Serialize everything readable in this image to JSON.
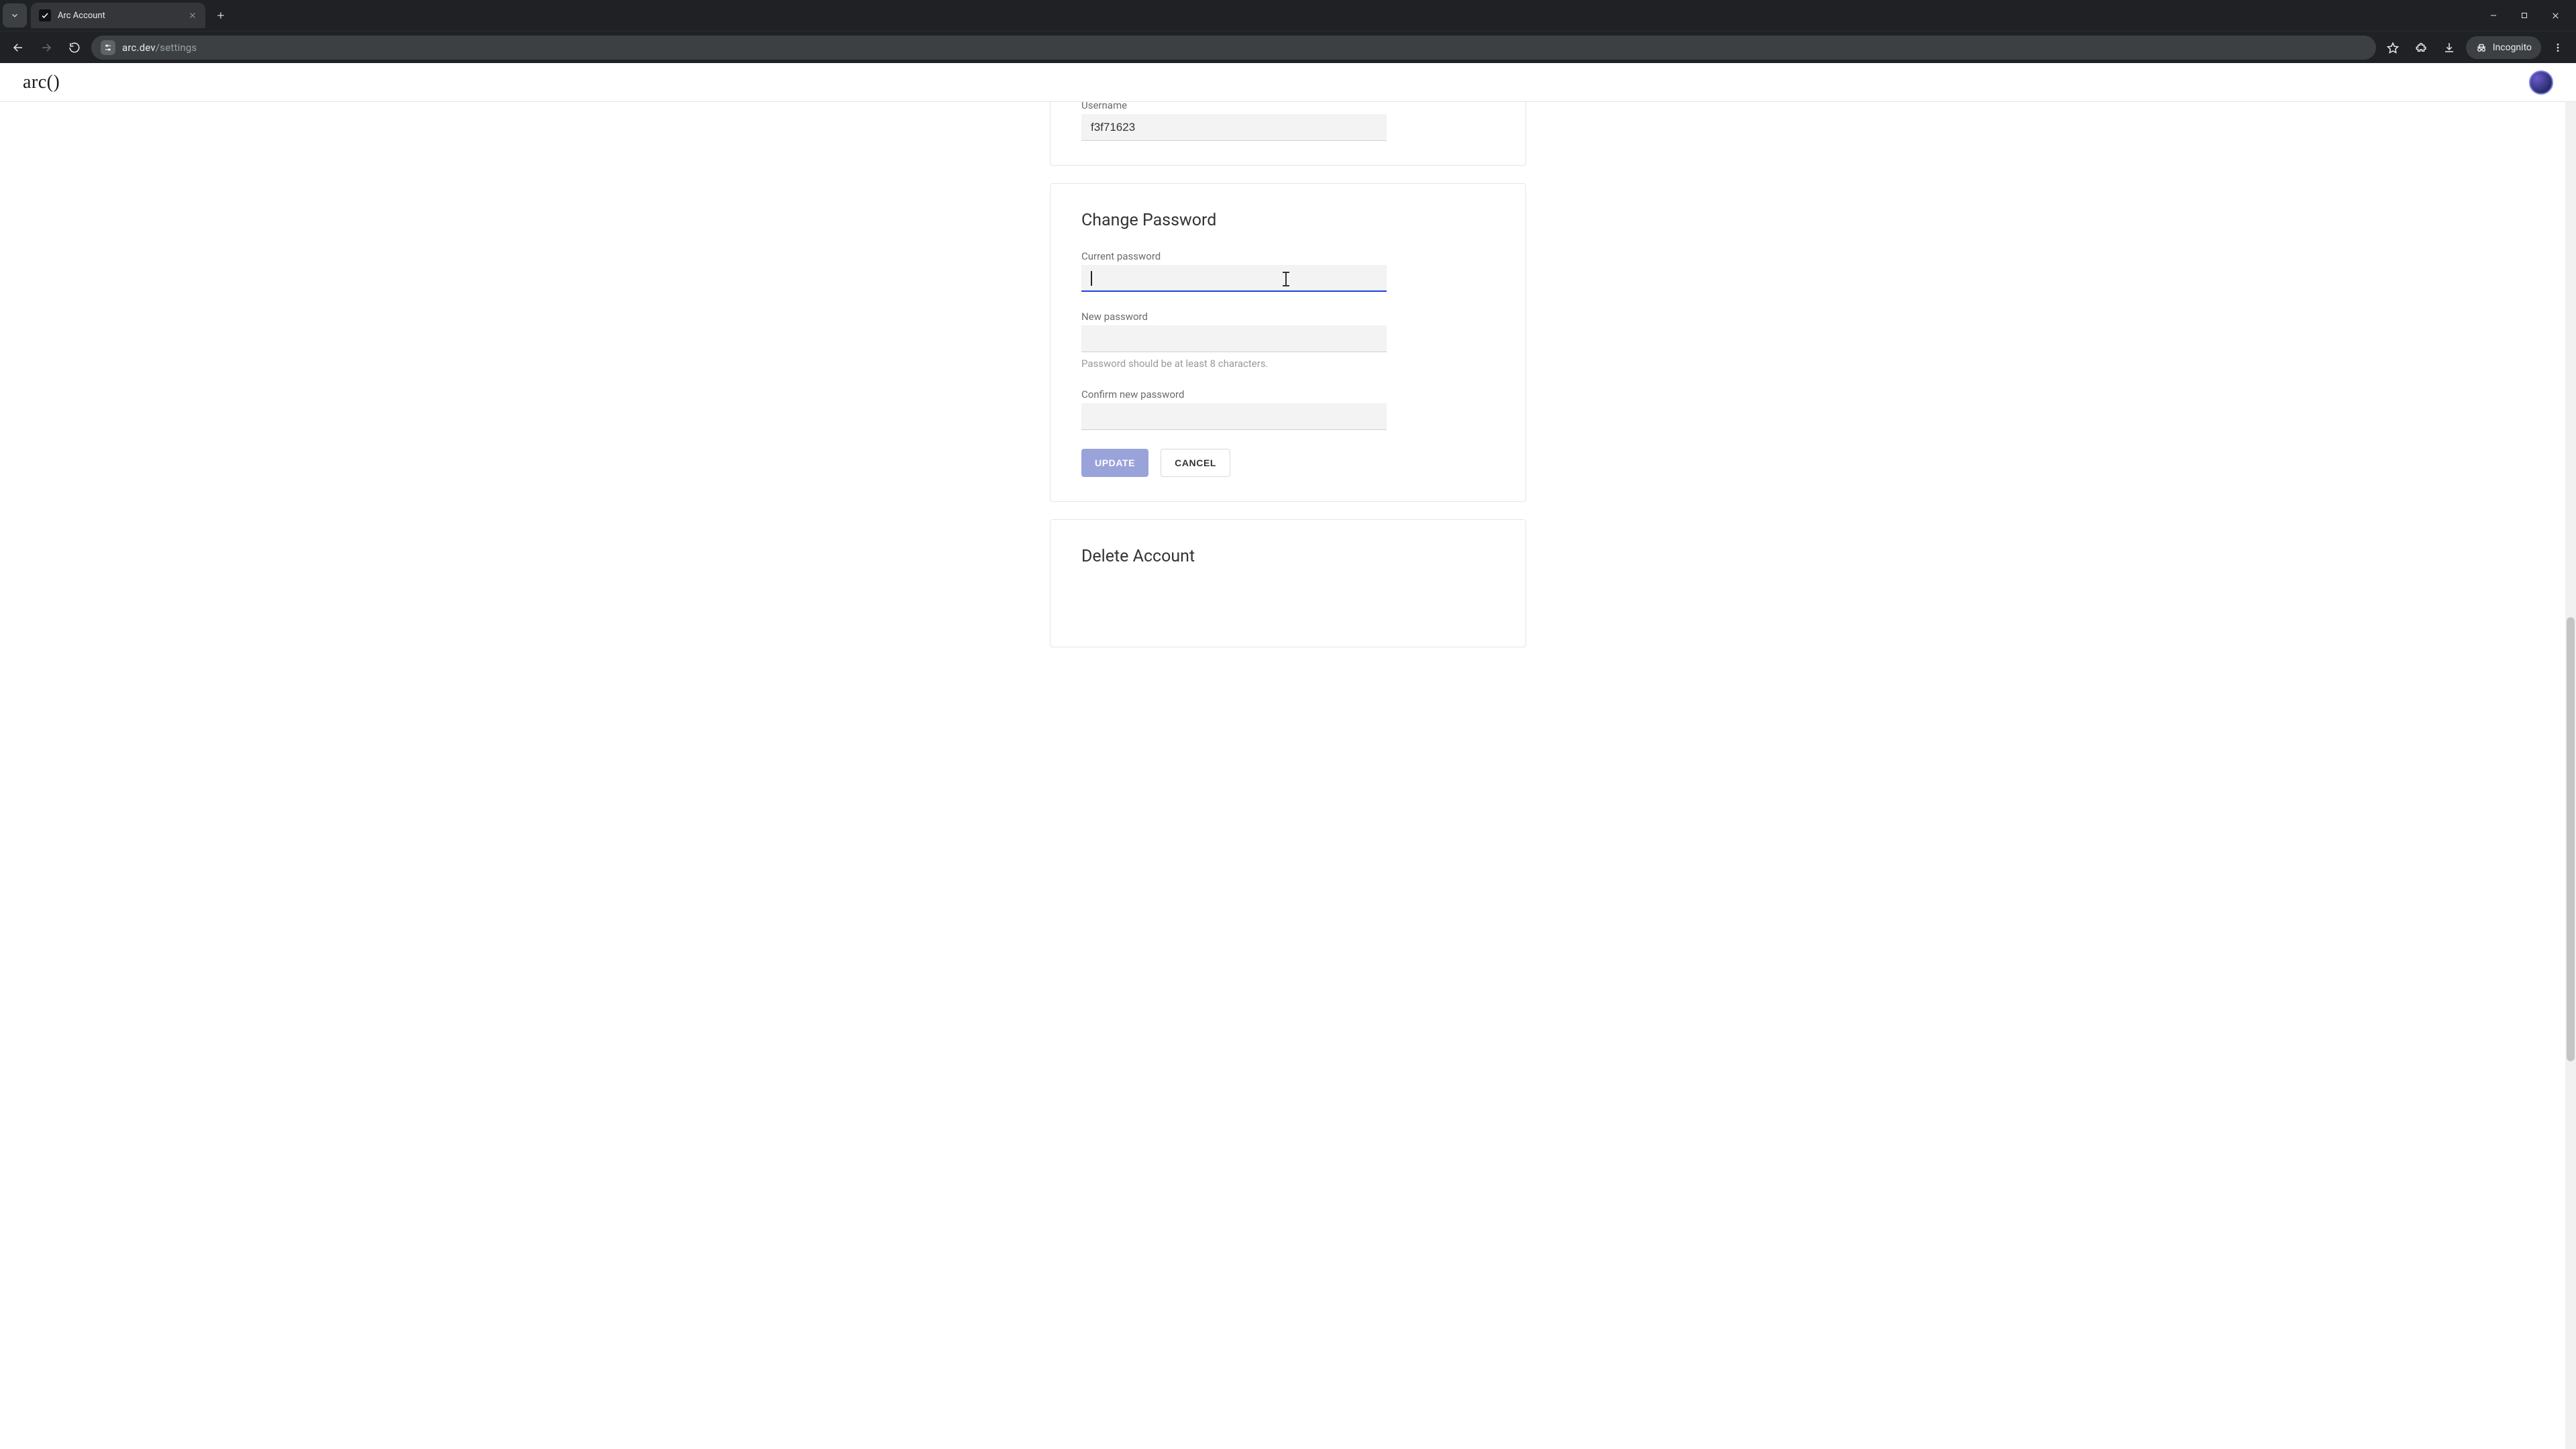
{
  "browser": {
    "tab_title": "Arc Account",
    "url_host": "arc.dev",
    "url_path": "/settings",
    "incognito_label": "Incognito"
  },
  "header": {
    "logo_text": "arc()"
  },
  "username_card": {
    "label": "Username",
    "value": "f3f71623"
  },
  "change_password": {
    "title": "Change Password",
    "current_label": "Current password",
    "current_value": "",
    "new_label": "New password",
    "new_value": "",
    "helper": "Password should be at least 8 characters.",
    "confirm_label": "Confirm new password",
    "confirm_value": "",
    "update_label": "UPDATE",
    "cancel_label": "CANCEL"
  },
  "delete_account": {
    "title": "Delete Account"
  }
}
